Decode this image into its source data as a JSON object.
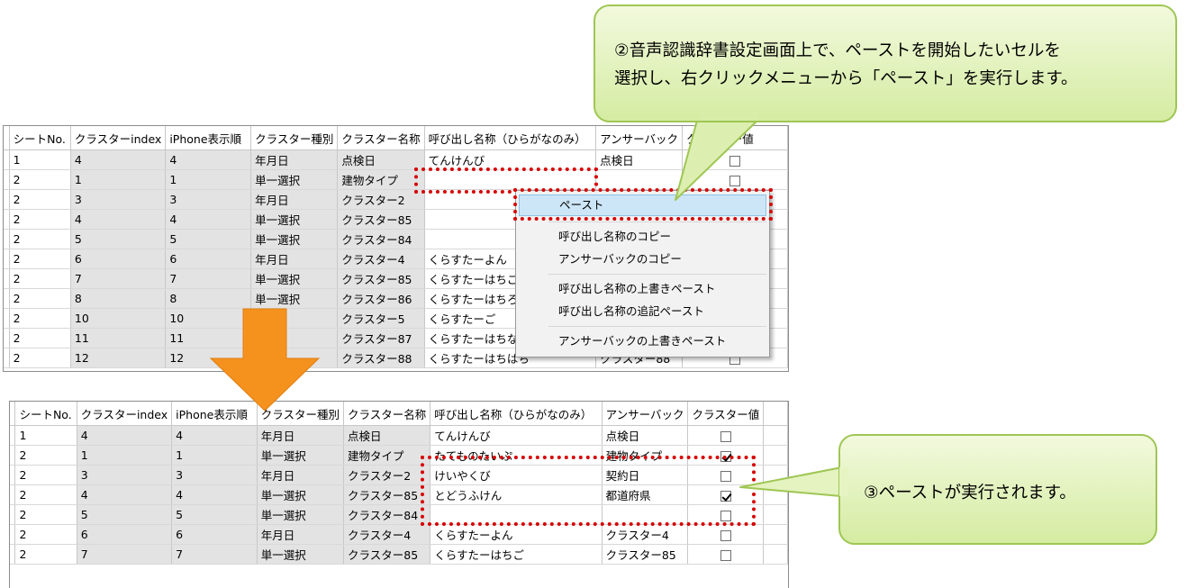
{
  "colors": {
    "callout_fill": "#e4f3bf",
    "callout_border": "#9fc654",
    "highlight_dots": "#d60000",
    "arrow": "#f5921e",
    "gray_cell": "#e3e3e3",
    "menu_highlight": "#cde6f7"
  },
  "callout_top": {
    "line1": "②音声認識辞書設定画面上で、ペーストを開始したいセルを",
    "line2": "選択し、右クリックメニューから「ペースト」を実行します。"
  },
  "callout_bottom": {
    "text": "③ペーストが実行されます。"
  },
  "table_top": {
    "headers": [
      "シートNo.",
      "クラスターindex",
      "iPhone表示順",
      "クラスター種別",
      "クラスター名称",
      "呼び出し名称（ひらがなのみ）",
      "アンサーバック",
      "クラスター値"
    ],
    "rows": [
      [
        "1",
        "4",
        "4",
        "年月日",
        "点検日",
        "てんけんび",
        "点検日",
        ""
      ],
      [
        "2",
        "1",
        "1",
        "単一選択",
        "建物タイプ",
        "",
        "",
        ""
      ],
      [
        "2",
        "3",
        "3",
        "年月日",
        "クラスター2",
        "",
        "",
        ""
      ],
      [
        "2",
        "4",
        "4",
        "単一選択",
        "クラスター85",
        "",
        "",
        ""
      ],
      [
        "2",
        "5",
        "5",
        "単一選択",
        "クラスター84",
        "",
        "",
        ""
      ],
      [
        "2",
        "6",
        "6",
        "年月日",
        "クラスター4",
        "くらすたーよん",
        "",
        ""
      ],
      [
        "2",
        "7",
        "7",
        "単一選択",
        "クラスター85",
        "くらすたーはちご",
        "",
        ""
      ],
      [
        "2",
        "8",
        "8",
        "単一選択",
        "クラスター86",
        "くらすたーはちろく",
        "",
        ""
      ],
      [
        "2",
        "10",
        "10",
        "",
        "クラスター5",
        "くらすたーご",
        "",
        ""
      ],
      [
        "2",
        "11",
        "11",
        "",
        "クラスター87",
        "くらすたーはちなな",
        "",
        ""
      ],
      [
        "2",
        "12",
        "12",
        "",
        "クラスター88",
        "くらすたーはちはち",
        "クラスター88",
        ""
      ]
    ]
  },
  "context_menu": {
    "paste": "ペースト",
    "copy_call_name": "呼び出し名称のコピー",
    "copy_answerback": "アンサーバックのコピー",
    "overwrite_paste_call_name": "呼び出し名称の上書きペースト",
    "append_paste_call_name": "呼び出し名称の追記ペースト",
    "overwrite_paste_answerback": "アンサーバックの上書きペースト"
  },
  "table_bottom": {
    "headers": [
      "シートNo.",
      "クラスターindex",
      "iPhone表示順",
      "クラスター種別",
      "クラスター名称",
      "呼び出し名称（ひらがなのみ）",
      "アンサーバック",
      "クラスター値"
    ],
    "rows": [
      [
        "1",
        "4",
        "4",
        "年月日",
        "点検日",
        "てんけんび",
        "点検日",
        ""
      ],
      [
        "2",
        "1",
        "1",
        "単一選択",
        "建物タイプ",
        "たてものたいぷ",
        "建物タイプ",
        ""
      ],
      [
        "2",
        "3",
        "3",
        "年月日",
        "クラスター2",
        "けいやくび",
        "契約日",
        ""
      ],
      [
        "2",
        "4",
        "4",
        "単一選択",
        "クラスター85",
        "とどうふけん",
        "都道府県",
        ""
      ],
      [
        "2",
        "5",
        "5",
        "単一選択",
        "クラスター84",
        "",
        "",
        ""
      ],
      [
        "2",
        "6",
        "6",
        "年月日",
        "クラスター4",
        "くらすたーよん",
        "クラスター4",
        ""
      ],
      [
        "2",
        "7",
        "7",
        "単一選択",
        "クラスター85",
        "くらすたーはちご",
        "クラスター85",
        ""
      ]
    ],
    "checked": [
      false,
      true,
      false,
      true,
      false,
      false,
      false
    ]
  }
}
